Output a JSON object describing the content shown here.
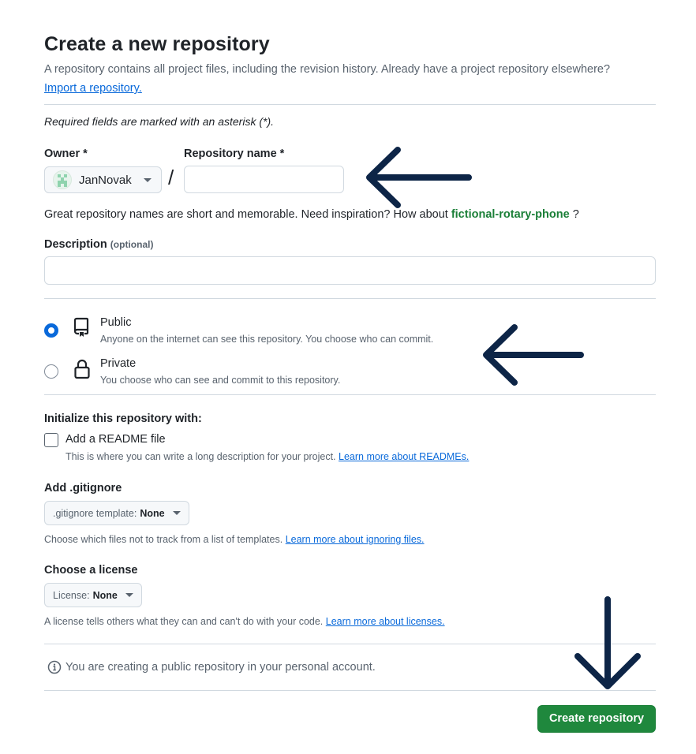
{
  "page": {
    "title": "Create a new repository",
    "subtitle": "A repository contains all project files, including the revision history. Already have a project repository elsewhere?",
    "import_link": "Import a repository.",
    "required_note": "Required fields are marked with an asterisk (*)."
  },
  "owner": {
    "label": "Owner *",
    "value": "JanNovak"
  },
  "separator": "/",
  "repo_name": {
    "label": "Repository name *",
    "value": "",
    "hint_prefix": "Great repository names are short and memorable. Need inspiration? How about",
    "suggestion": "fictional-rotary-phone",
    "hint_suffix": "?"
  },
  "description": {
    "label": "Description",
    "optional": "(optional)",
    "value": ""
  },
  "visibility": {
    "selected": "public",
    "options": [
      {
        "title": "Public",
        "desc": "Anyone on the internet can see this repository. You choose who can commit.",
        "icon": "repo-icon"
      },
      {
        "title": "Private",
        "desc": "You choose who can see and commit to this repository.",
        "icon": "lock-icon"
      }
    ]
  },
  "init": {
    "heading": "Initialize this repository with:",
    "readme_label": "Add a README file",
    "readme_checked": false,
    "readme_desc": "This is where you can write a long description for your project.",
    "readme_link": "Learn more about READMEs."
  },
  "gitignore": {
    "heading": "Add .gitignore",
    "select_prefix": ".gitignore template:",
    "select_value": "None",
    "note": "Choose which files not to track from a list of templates.",
    "note_link": "Learn more about ignoring files."
  },
  "license": {
    "heading": "Choose a license",
    "select_prefix": "License:",
    "select_value": "None",
    "note": "A license tells others what they can and can't do with your code.",
    "note_link": "Learn more about licenses."
  },
  "info_message": "You are creating a public repository in your personal account.",
  "submit_label": "Create repository",
  "colors": {
    "primary_button": "#1f883d",
    "link": "#0969da",
    "suggestion": "#1a7f37",
    "annotation_arrow": "#0d2547"
  }
}
